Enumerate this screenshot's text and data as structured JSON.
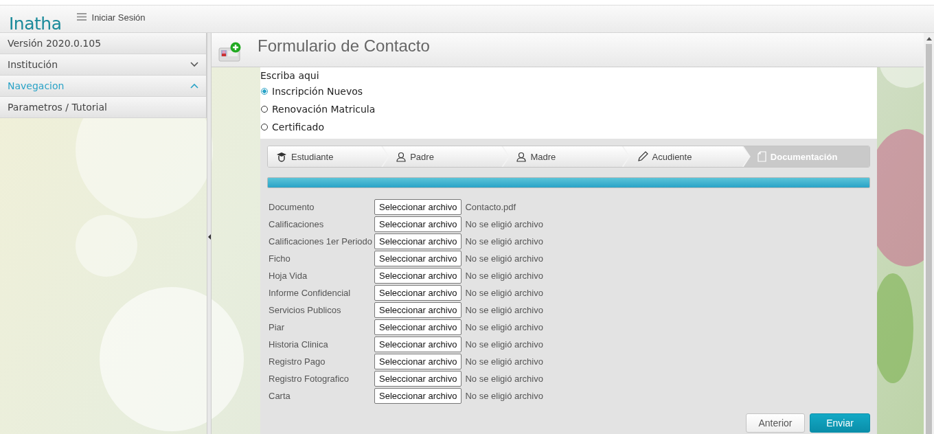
{
  "header": {
    "logo": "Inatha",
    "menu_label": "Iniciar Sesión"
  },
  "sidebar": {
    "items": [
      {
        "label": "Versión 2020.0.105"
      },
      {
        "label": "Institución",
        "expanded": false
      },
      {
        "label": "Navegacion",
        "expanded": true
      },
      {
        "label": "Parametros / Tutorial"
      }
    ]
  },
  "page": {
    "title": "Formulario de Contacto"
  },
  "form": {
    "prompt": "Escriba aqui",
    "options": [
      {
        "label": "Inscripción Nuevos",
        "selected": true
      },
      {
        "label": "Renovación Matricula",
        "selected": false
      },
      {
        "label": "Certificado",
        "selected": false
      }
    ],
    "steps": [
      {
        "label": "Estudiante",
        "kind": "cap",
        "selected": false
      },
      {
        "label": "Padre",
        "kind": "person",
        "selected": false
      },
      {
        "label": "Madre",
        "kind": "person",
        "selected": false
      },
      {
        "label": "Acudiente",
        "kind": "pencil",
        "selected": false
      },
      {
        "label": "Documentación",
        "kind": "document",
        "selected": true
      }
    ],
    "progress": {
      "level": 1
    },
    "files": [
      {
        "label": "Documento",
        "button": "Seleccionar archivo",
        "status": "Contacto.pdf"
      },
      {
        "label": "Calificaciones",
        "button": "Seleccionar archivo",
        "status": "No se eligió archivo"
      },
      {
        "label": "Calificaciones 1er Periodo",
        "button": "Seleccionar archivo",
        "status": "No se eligió archivo"
      },
      {
        "label": "Ficho",
        "button": "Seleccionar archivo",
        "status": "No se eligió archivo"
      },
      {
        "label": "Hoja Vida",
        "button": "Seleccionar archivo",
        "status": "No se eligió archivo"
      },
      {
        "label": "Informe Confidencial",
        "button": "Seleccionar archivo",
        "status": "No se eligió archivo"
      },
      {
        "label": "Servicios Publicos",
        "button": "Seleccionar archivo",
        "status": "No se eligió archivo"
      },
      {
        "label": "Piar",
        "button": "Seleccionar archivo",
        "status": "No se eligió archivo"
      },
      {
        "label": "Historia Clinica",
        "button": "Seleccionar archivo",
        "status": "No se eligió archivo"
      },
      {
        "label": "Registro Pago",
        "button": "Seleccionar archivo",
        "status": "No se eligió archivo"
      },
      {
        "label": "Registro Fotografico",
        "button": "Seleccionar archivo",
        "status": "No se eligió archivo"
      },
      {
        "label": "Carta",
        "button": "Seleccionar archivo",
        "status": "No se eligió archivo"
      }
    ],
    "buttons": [
      {
        "label": "Anterior",
        "kind": "secondary"
      },
      {
        "label": "Enviar",
        "kind": "primary"
      }
    ]
  }
}
